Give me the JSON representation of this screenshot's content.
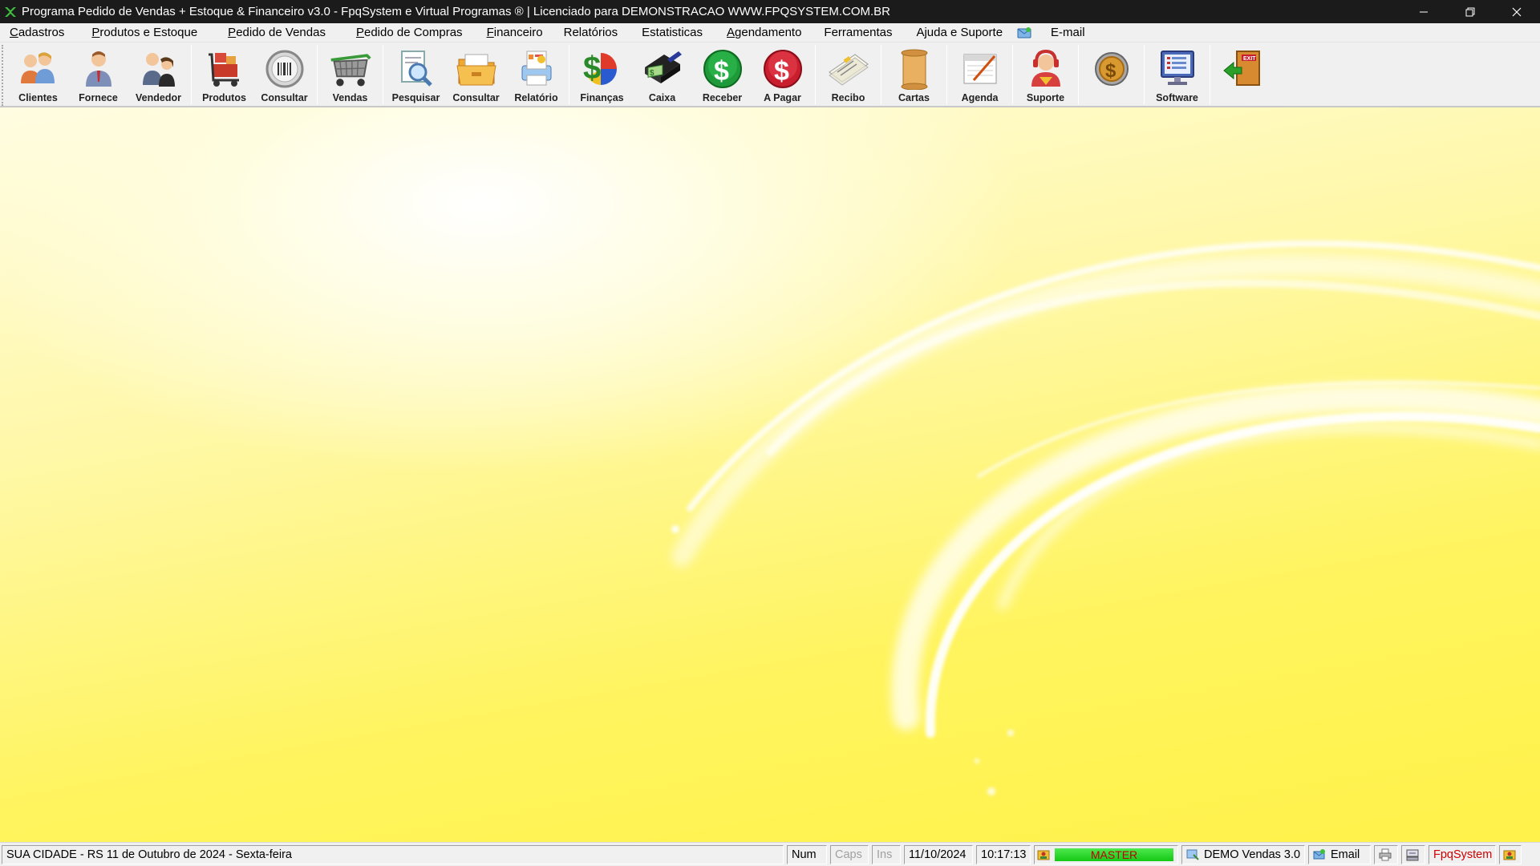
{
  "window": {
    "title": "Programa Pedido de Vendas + Estoque & Financeiro v3.0 - FpqSystem e Virtual Programas ® | Licenciado para  DEMONSTRACAO WWW.FPQSYSTEM.COM.BR",
    "minimize_icon": "minimize-icon",
    "restore_icon": "restore-icon",
    "close_icon": "close-icon"
  },
  "menu": {
    "items": [
      {
        "label": "Cadastros"
      },
      {
        "label": "Produtos e Estoque"
      },
      {
        "label": "Pedido de Vendas"
      },
      {
        "label": "Pedido de Compras"
      },
      {
        "label": "Financeiro"
      },
      {
        "label": "Relatórios"
      },
      {
        "label": "Estatisticas"
      },
      {
        "label": "Agendamento"
      },
      {
        "label": "Ferramentas"
      },
      {
        "label": "Ajuda e Suporte"
      }
    ],
    "email_icon": "email-app-icon",
    "email_label": "E-mail"
  },
  "toolbar": {
    "buttons": [
      {
        "label": "Clientes",
        "icon": "clients-icon"
      },
      {
        "label": "Fornece",
        "icon": "supplier-icon"
      },
      {
        "label": "Vendedor",
        "icon": "salesperson-icon"
      },
      {
        "label": "Produtos",
        "icon": "products-icon"
      },
      {
        "label": "Consultar",
        "icon": "barcode-icon"
      },
      {
        "label": "Vendas",
        "icon": "shopping-cart-icon"
      },
      {
        "label": "Pesquisar",
        "icon": "search-document-icon"
      },
      {
        "label": "Consultar",
        "icon": "folder-box-icon"
      },
      {
        "label": "Relatório",
        "icon": "report-printer-icon"
      },
      {
        "label": "Finanças",
        "icon": "finance-dollar-icon"
      },
      {
        "label": "Caixa",
        "icon": "cashbook-icon"
      },
      {
        "label": "Receber",
        "icon": "receive-dollar-icon"
      },
      {
        "label": "A Pagar",
        "icon": "pay-dollar-icon"
      },
      {
        "label": "Recibo",
        "icon": "receipt-icon"
      },
      {
        "label": "Cartas",
        "icon": "letter-scroll-icon"
      },
      {
        "label": "Agenda",
        "icon": "agenda-icon"
      },
      {
        "label": "Suporte",
        "icon": "support-icon"
      },
      {
        "label": "",
        "icon": "coin-icon"
      },
      {
        "label": "Software",
        "icon": "software-monitor-icon"
      },
      {
        "label": "",
        "icon": "exit-door-icon"
      }
    ]
  },
  "colors": {
    "titlebar": "#1b1b1b",
    "desktop_yellow": "#fff24a",
    "master_green": "#14c814",
    "master_text": "#c00000",
    "brand_red": "#d00000"
  },
  "status": {
    "location_date": "SUA CIDADE - RS 11 de Outubro de 2024 - Sexta-feira",
    "num": "Num",
    "caps": "Caps",
    "ins": "Ins",
    "date": "11/10/2024",
    "time": "10:17:13",
    "user": "MASTER",
    "version": "DEMO Vendas 3.0",
    "email": "Email",
    "brand": "FpqSystem"
  }
}
